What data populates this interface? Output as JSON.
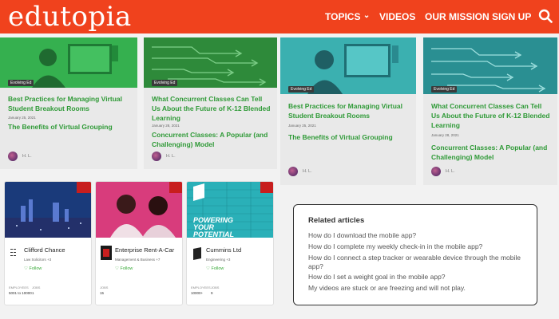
{
  "header": {
    "logo": "edutopia",
    "nav": [
      "TOPICS",
      "VIDEOS",
      "OUR MISSION",
      "SIGN UP"
    ],
    "topics_chevron": "⌄",
    "accent": "#f0421d"
  },
  "articles": {
    "left": [
      {
        "badge": "Evolving Ed",
        "title": "Best Practices for Managing Virtual Student Breakout Rooms",
        "date": "January 25, 2021",
        "subtitle": "The Benefits of Virtual Grouping",
        "author": "H. L."
      },
      {
        "badge": "Evolving Ed",
        "title": "What Concurrent Classes Can Tell Us About the Future of K-12 Blended Learning",
        "date": "January 28, 2021",
        "subtitle": "Concurrent Classes: A Popular (and Challenging) Model",
        "author": "H. L."
      }
    ],
    "right": [
      {
        "badge": "Evolving Ed",
        "title": "Best Practices for Managing Virtual Student Breakout Rooms",
        "date": "January 25, 2021",
        "subtitle": "The Benefits of Virtual Grouping",
        "author": "H. L."
      },
      {
        "badge": "Evolving Ed",
        "title": "What Concurrent Classes Can Tell Us About the Future of K-12 Blended Learning",
        "date": "January 28, 2021",
        "subtitle": "Concurrent Classes: A Popular (and Challenging) Model",
        "author": "H. L."
      }
    ]
  },
  "companies": [
    {
      "name": "Clifford Chance",
      "industry": "Law Solicitors +3",
      "follow": "Follow",
      "meta1": "EMPLOYEES",
      "meta2": "JOBS",
      "val1": "5001 to 10000",
      "val2": "1"
    },
    {
      "name": "Enterprise Rent-A-Car",
      "industry": "Management & Business +7",
      "follow": "Follow",
      "meta1": "JOBS",
      "meta2": "",
      "val1": "15",
      "val2": ""
    },
    {
      "name": "Cummins Ltd",
      "industry": "Engineering +3",
      "follow": "Follow",
      "meta1": "EMPLOYEES",
      "meta2": "JOBS",
      "val1": "10000+",
      "val2": "9",
      "banner": "POWERING YOUR POTENTIAL"
    }
  ],
  "related": {
    "title": "Related articles",
    "items": [
      "How do I download the mobile app?",
      "How do I complete my weekly check-in in the mobile app?",
      "How do I connect a step tracker or wearable device through the mobile app?",
      "How do I set a weight goal in the mobile app?",
      "My videos are stuck or are freezing and will not play."
    ]
  }
}
